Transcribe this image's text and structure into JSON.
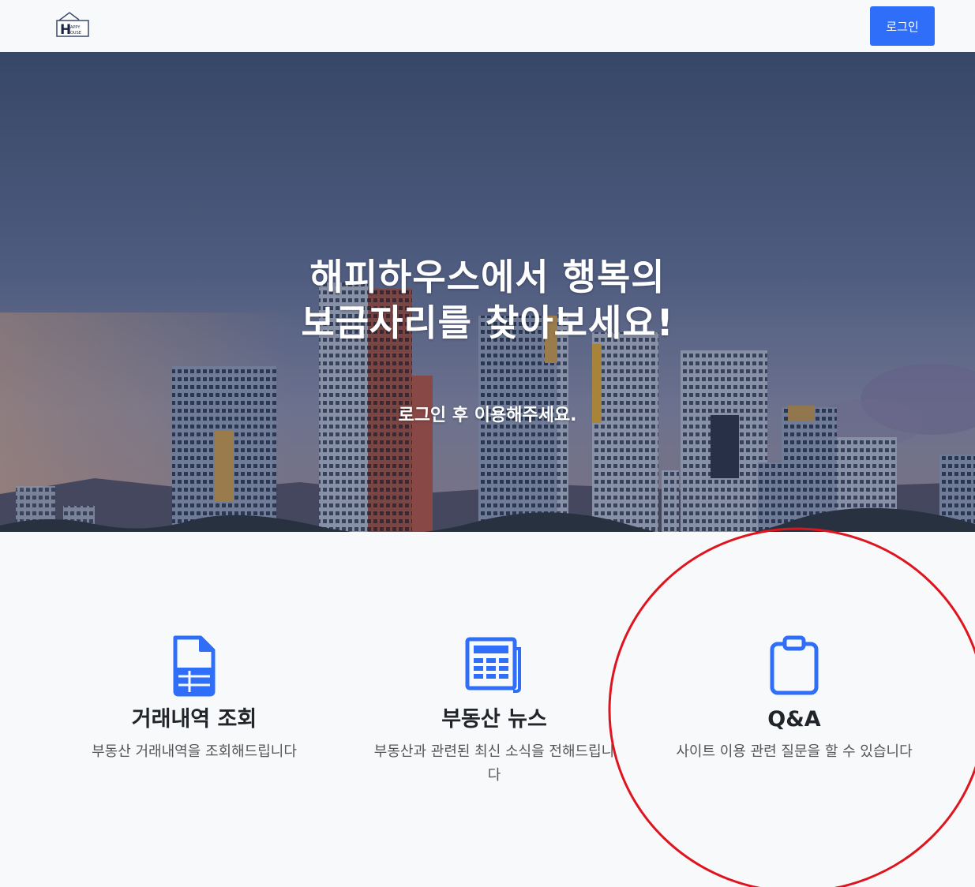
{
  "nav": {
    "logo_letter": "H",
    "logo_text_top": "APPY",
    "logo_text_bottom": "OUSE",
    "login_label": "로그인"
  },
  "hero": {
    "title_line1": "해피하우스에서 행복의",
    "title_line2": "보금자리를 찾아보세요!",
    "subtitle": "로그인 후 이용해주세요."
  },
  "features": [
    {
      "icon": "file-table-icon",
      "title": "거래내역 조회",
      "description": "부동산 거래내역을 조회해드립니다"
    },
    {
      "icon": "newspaper-icon",
      "title": "부동산 뉴스",
      "description": "부동산과 관련된 최신 소식을 전해드립니다"
    },
    {
      "icon": "clipboard-icon",
      "title": "Q&A",
      "description": "사이트 이용 관련 질문을 할 수 있습니다"
    }
  ],
  "colors": {
    "accent": "#2f6ef8",
    "highlight_circle": "#e0141e"
  }
}
